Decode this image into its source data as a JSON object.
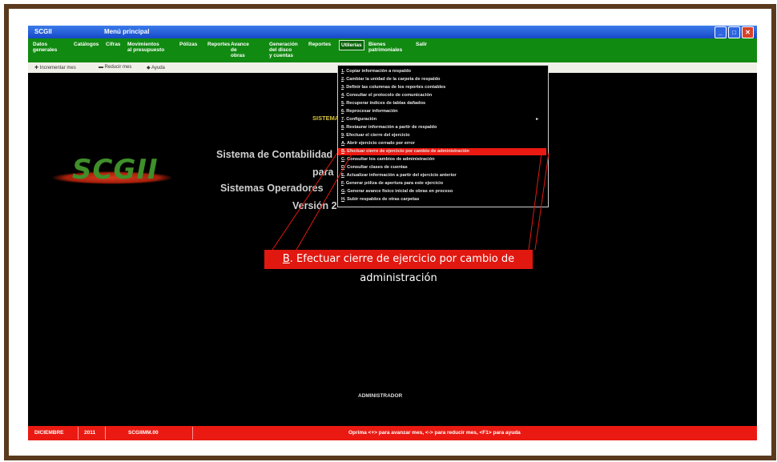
{
  "window": {
    "app_title": "SCGII",
    "subtitle": "Menú principal"
  },
  "menubar": [
    {
      "label": "Datos generales",
      "lines": [
        "Datos",
        "generales"
      ]
    },
    {
      "label": "Catálogos",
      "lines": [
        "Catálogos"
      ]
    },
    {
      "label": "Cifras",
      "lines": [
        "Cifras"
      ]
    },
    {
      "label": "Movimientos al presupuesto",
      "lines": [
        "Movimientos",
        "al presupuesto"
      ]
    },
    {
      "label": "Pólizas",
      "lines": [
        "Pólizas"
      ]
    },
    {
      "label": "Reportes",
      "lines": [
        "Reportes"
      ]
    },
    {
      "label": "Avance de obras",
      "lines": [
        "Avance",
        "de",
        "obras"
      ]
    },
    {
      "label": "Generación del disco y cuentas",
      "lines": [
        "Generación",
        "del disco",
        "y cuentas"
      ]
    },
    {
      "label": "Reportes",
      "lines": [
        "Reportes"
      ]
    },
    {
      "label": "Utilerías",
      "lines": [
        "Utilerías"
      ],
      "active": true
    },
    {
      "label": "Bienes patrimoniales",
      "lines": [
        "Bienes",
        "patrimoniales"
      ]
    },
    {
      "label": "Salir",
      "lines": [
        "Salir"
      ]
    }
  ],
  "toolbar": {
    "increase": "Incrementar mes",
    "decrease": "Reducir mes",
    "help": "Ayuda"
  },
  "content": {
    "sistema_heading": "SISTEMA",
    "line1": "Sistema de Contabilidad",
    "line2": "para",
    "line3": "Sistemas Operadores",
    "line4": "Versión 2",
    "logo_text": "SCGII",
    "admin": "ADMINISTRADOR"
  },
  "dropdown": [
    {
      "key": "1",
      "label": "Copiar información a respaldo"
    },
    {
      "key": "2",
      "label": "Cambiar la unidad de la carpeta de respaldo"
    },
    {
      "key": "3",
      "label": "Definir las columnas de los reportes contables"
    },
    {
      "key": "4",
      "label": "Consultar el protocolo de comunicación"
    },
    {
      "key": "5",
      "label": "Recuperar índices de tablas dañados"
    },
    {
      "key": "6",
      "label": "Reprocesar información"
    },
    {
      "key": "7",
      "label": "Configuración",
      "submenu": true
    },
    {
      "key": "8",
      "label": "Restaurar información a partir de respaldo"
    },
    {
      "key": "9",
      "label": "Efectuar el cierre del ejercicio"
    },
    {
      "key": "A",
      "label": "Abrir ejercicio cerrado por error"
    },
    {
      "key": "B",
      "label": "Efectuar cierre de ejercicio por cambio de administración",
      "highlight": true
    },
    {
      "key": "C",
      "label": "Consultar los cambios de administración"
    },
    {
      "key": "D",
      "label": "Consultar clases de cuentas"
    },
    {
      "key": "E",
      "label": "Actualizar información a partir del ejercicio anterior"
    },
    {
      "key": "F",
      "label": "Generar póliza de apertura para este ejercicio"
    },
    {
      "key": "G",
      "label": "Generar avance físico inicial de obras en proceso"
    },
    {
      "key": "H",
      "label": "Subir respaldos de otras carpetas"
    }
  ],
  "callout": {
    "key": "B",
    "text": ". Efectuar cierre de ejercicio por cambio de administración"
  },
  "statusbar": {
    "month": "DICIEMBRE",
    "year": "2011",
    "user": "SCGIIMM.00",
    "hint": "Oprima <+> para avanzar mes, <-> para reducir mes, <F1> para ayuda"
  },
  "colors": {
    "menubar": "#118a11",
    "statusbar": "#ea1a12",
    "frame": "#5a3a1e",
    "highlight": "#ea1a12"
  }
}
